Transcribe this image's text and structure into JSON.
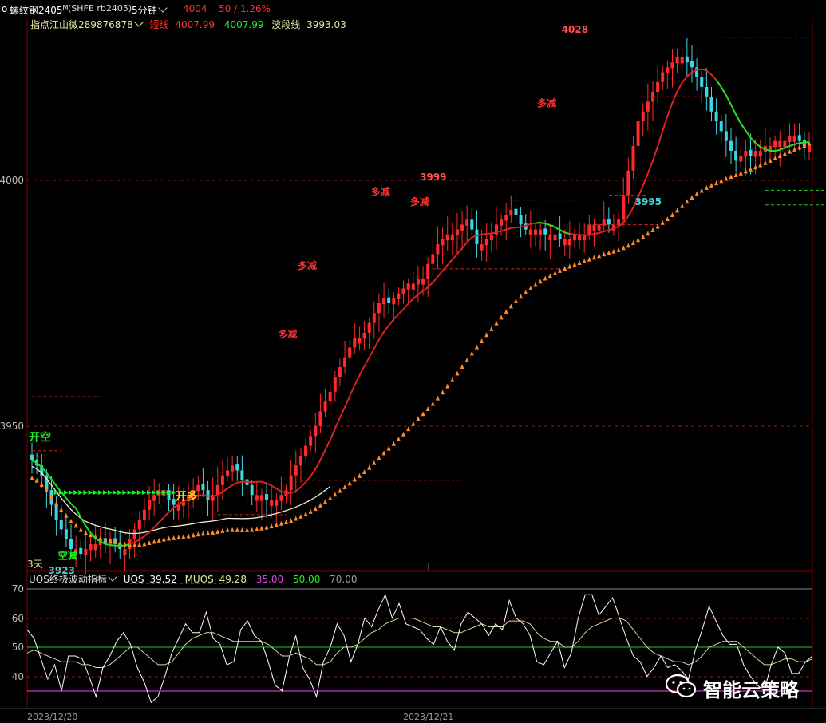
{
  "header": {
    "prefix": "o",
    "symbol_name": "螺纹钢2405",
    "symbol_sup": "M",
    "exchange_code": "(SHFE rb2405)",
    "period": "5分钟",
    "last_price": "4004",
    "change": "50 / 1.26%"
  },
  "main_indicator": {
    "name": "指点江山微289876878",
    "short_label": "短线",
    "short_value": "4007.99",
    "green_value": "4007.99",
    "wave_label": "波段线",
    "wave_value": "3993.03"
  },
  "sub_indicator": {
    "name": "UOS终极波动指标",
    "uos_label": "UOS",
    "uos_value": "39.52",
    "muos_label": "MUOS",
    "muos_value": "49.28",
    "level1": "35.00",
    "level2": "50.00",
    "level3": "70.00"
  },
  "left_label": "3天",
  "dates": [
    "2023/12/20",
    "2023/12/21"
  ],
  "watermark": "智能云策略",
  "colors": {
    "up": "#ff2a2a",
    "down": "#3dd6e0",
    "short_line_red": "#e02020",
    "short_line_green": "#22dd22",
    "wave_line": "#ff8a2a",
    "signal_bull": "#ff3030",
    "signal_green": "#22ee22",
    "signal_yellow": "#ffd700"
  },
  "chart_data": [
    {
      "type": "candlestick",
      "title": "螺纹钢2405 5分钟",
      "y_ticks": [
        3950,
        4000
      ],
      "ylim": [
        3917,
        4054
      ],
      "annotations": [
        {
          "text": "开空",
          "kind": "signal"
        },
        {
          "text": "空减",
          "kind": "signal"
        },
        {
          "text": "开多",
          "kind": "signal"
        },
        {
          "text": "多减",
          "kind": "signal"
        },
        {
          "text": "多减",
          "kind": "signal"
        },
        {
          "text": "多减",
          "kind": "signal"
        },
        {
          "text": "多减",
          "kind": "signal"
        },
        {
          "text": "多减",
          "kind": "signal"
        },
        {
          "text": "3923",
          "kind": "low"
        },
        {
          "text": "3999",
          "kind": "high"
        },
        {
          "text": "4028",
          "kind": "high"
        },
        {
          "text": "3995",
          "kind": "low"
        }
      ],
      "close": [
        3943,
        3942,
        3940,
        3937,
        3934,
        3931,
        3929,
        3927,
        3925,
        3925,
        3924,
        3925,
        3926,
        3926,
        3927,
        3926,
        3927,
        3926,
        3925,
        3925,
        3927,
        3929,
        3931,
        3933,
        3935,
        3936,
        3937,
        3937,
        3935,
        3934,
        3934,
        3935,
        3936,
        3937,
        3938,
        3937,
        3935,
        3936,
        3938,
        3940,
        3941,
        3942,
        3941,
        3939,
        3938,
        3936,
        3936,
        3936,
        3935,
        3935,
        3935,
        3936,
        3937,
        3940,
        3942,
        3944,
        3946,
        3948,
        3950,
        3953,
        3955,
        3957,
        3960,
        3962,
        3964,
        3966,
        3968,
        3968,
        3969,
        3971,
        3973,
        3975,
        3976,
        3975,
        3976,
        3977,
        3978,
        3979,
        3979,
        3980,
        3980,
        3983,
        3985,
        3987,
        3988,
        3989,
        3989,
        3990,
        3991,
        3992,
        3990,
        3987,
        3987,
        3988,
        3989,
        3991,
        3992,
        3993,
        3994,
        3993,
        3991,
        3990,
        3990,
        3990,
        3990,
        3989,
        3989,
        3989,
        3988,
        3988,
        3988,
        3989,
        3989,
        3989,
        3991,
        3991,
        3991,
        3992,
        3991,
        3991,
        3992,
        3997,
        4002,
        4007,
        4012,
        4014,
        4016,
        4018,
        4020,
        4022,
        4023,
        4024,
        4025,
        4025,
        4024,
        4023,
        4021,
        4019,
        4017,
        4014,
        4012,
        4010,
        4008,
        4006,
        4004,
        4005,
        4006,
        4005,
        4006,
        4006,
        4007,
        4007,
        4008,
        4008,
        4008,
        4009,
        4009,
        4008,
        4007,
        4007
      ]
    },
    {
      "type": "line",
      "title": "UOS终极波动指标",
      "ylim": [
        30,
        72
      ],
      "y_ticks": [
        40,
        50,
        60,
        70
      ],
      "reference_lines": [
        35,
        50,
        70
      ],
      "series": [
        {
          "name": "UOS",
          "values": [
            56,
            53,
            46,
            39,
            44,
            35,
            47,
            47,
            46,
            40,
            33,
            43,
            47,
            52,
            55,
            51,
            43,
            38,
            31,
            33,
            40,
            48,
            53,
            58,
            55,
            55,
            62,
            53,
            51,
            44,
            45,
            56,
            59,
            54,
            52,
            45,
            37,
            35,
            46,
            54,
            43,
            39,
            33,
            45,
            50,
            58,
            54,
            45,
            51,
            60,
            57,
            63,
            68,
            60,
            65,
            58,
            57,
            56,
            53,
            51,
            57,
            52,
            49,
            58,
            62,
            60,
            58,
            54,
            58,
            56,
            66,
            60,
            58,
            54,
            45,
            44,
            48,
            52,
            43,
            48,
            60,
            68,
            68,
            61,
            64,
            67,
            60,
            53,
            47,
            45,
            40,
            43,
            47,
            43,
            44,
            42,
            39,
            49,
            56,
            64,
            59,
            54,
            51,
            51,
            44,
            40,
            37,
            35,
            44,
            50,
            48,
            41,
            41,
            45,
            47
          ]
        },
        {
          "name": "MUOS",
          "values": [
            48,
            49,
            48,
            47,
            46,
            45,
            45,
            45,
            44,
            44,
            43,
            43,
            44,
            46,
            48,
            50,
            50,
            48,
            46,
            44,
            44,
            45,
            48,
            51,
            53,
            54,
            55,
            55,
            54,
            53,
            52,
            52,
            52,
            52,
            52,
            51,
            49,
            47,
            47,
            48,
            47,
            46,
            44,
            44,
            45,
            48,
            50,
            50,
            51,
            53,
            55,
            56,
            58,
            59,
            60,
            60,
            60,
            59,
            58,
            57,
            57,
            56,
            55,
            55,
            56,
            57,
            58,
            57,
            57,
            57,
            59,
            59,
            59,
            58,
            55,
            53,
            52,
            52,
            50,
            50,
            52,
            55,
            57,
            58,
            59,
            60,
            60,
            59,
            56,
            53,
            50,
            48,
            47,
            46,
            45,
            45,
            44,
            45,
            47,
            50,
            51,
            52,
            52,
            52,
            50,
            48,
            46,
            44,
            44,
            45,
            46,
            46,
            45,
            45,
            46
          ]
        }
      ]
    }
  ]
}
